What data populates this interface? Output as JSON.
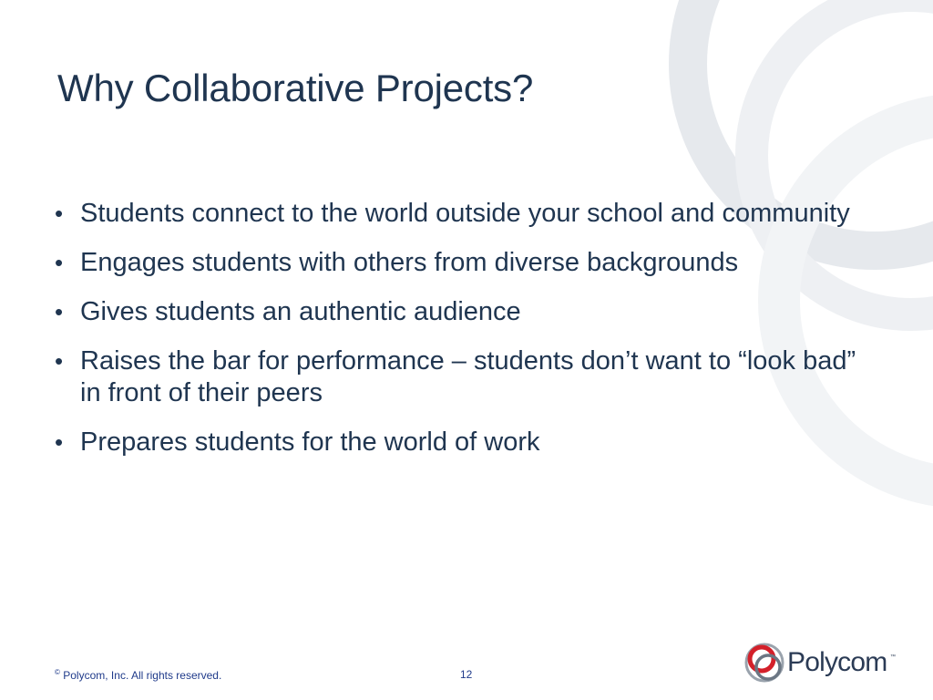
{
  "slide": {
    "title": "Why Collaborative Projects?",
    "bullet_marker": "•",
    "bullets": [
      "Students connect to the world outside your school and community",
      "Engages students with others from diverse backgrounds",
      "Gives students an authentic audience",
      "Raises the bar for performance – students don’t want to “look bad” in front of their peers",
      "Prepares students for the world of work"
    ]
  },
  "footer": {
    "copyright_symbol": "©",
    "copyright_text": "Polycom, Inc. All rights reserved.",
    "page_number": "12"
  },
  "logo": {
    "wordmark": "Polycom",
    "trademark": "™"
  },
  "colors": {
    "text": "#1f3550",
    "footer": "#1f3a8a",
    "logo_red": "#d3202a",
    "decor_gray": "#e6e9ed"
  },
  "icons": {
    "logo_mark": "polycom-logo-icon",
    "background": "decorative-circles"
  }
}
